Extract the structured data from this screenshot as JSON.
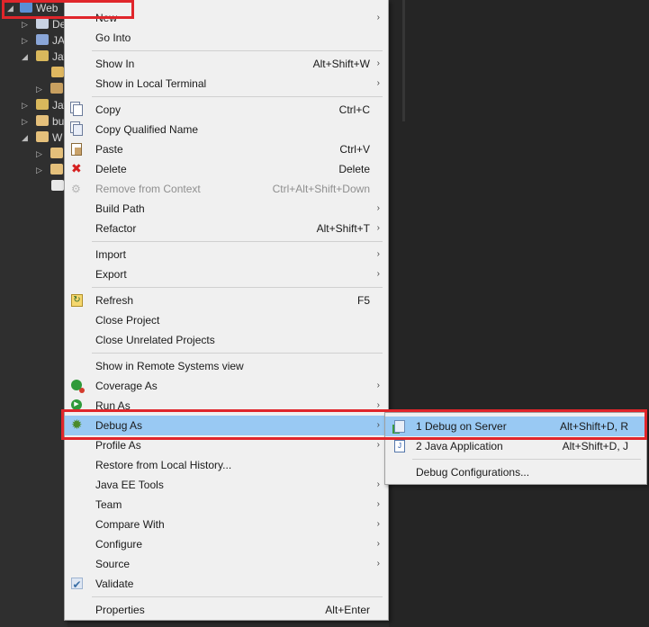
{
  "explorer": {
    "rows": [
      {
        "label": "Web",
        "twisty": "◢",
        "icon": "project-icon"
      },
      {
        "label": "De",
        "twisty": "▷",
        "icon": "deployment-descriptor-icon"
      },
      {
        "label": "JA",
        "twisty": "▷",
        "icon": "jaxws-icon"
      },
      {
        "label": "Jav",
        "twisty": "◢",
        "icon": "java-resources-icon"
      },
      {
        "label": "",
        "twisty": "",
        "icon": "package-folder-icon"
      },
      {
        "label": "",
        "twisty": "▷",
        "icon": "libraries-icon"
      },
      {
        "label": "Jav",
        "twisty": "▷",
        "icon": "java-script-resources-icon"
      },
      {
        "label": "bu",
        "twisty": "▷",
        "icon": "folder-icon"
      },
      {
        "label": "W",
        "twisty": "◢",
        "icon": "folder-icon"
      },
      {
        "label": "",
        "twisty": "▷",
        "icon": "folder-icon"
      },
      {
        "label": "",
        "twisty": "▷",
        "icon": "folder-icon"
      },
      {
        "label": "",
        "twisty": "",
        "icon": "file-icon"
      }
    ]
  },
  "menu": {
    "items": [
      {
        "label": "New",
        "arrow": "›"
      },
      {
        "label": "Go Into"
      },
      {
        "sep": true
      },
      {
        "label": "Show In",
        "shortcut": "Alt+Shift+W",
        "arrow": "›"
      },
      {
        "label": "Show in Local Terminal",
        "arrow": "›"
      },
      {
        "sep": true
      },
      {
        "label": "Copy",
        "shortcut": "Ctrl+C",
        "icon": "copy-icon"
      },
      {
        "label": "Copy Qualified Name",
        "icon": "copy-qualified-icon"
      },
      {
        "label": "Paste",
        "shortcut": "Ctrl+V",
        "icon": "paste-icon"
      },
      {
        "label": "Delete",
        "shortcut": "Delete",
        "icon": "delete-icon"
      },
      {
        "label": "Remove from Context",
        "shortcut": "Ctrl+Alt+Shift+Down",
        "icon": "remove-context-icon",
        "disabled": true
      },
      {
        "label": "Build Path",
        "arrow": "›"
      },
      {
        "label": "Refactor",
        "shortcut": "Alt+Shift+T",
        "arrow": "›"
      },
      {
        "sep": true
      },
      {
        "label": "Import",
        "arrow": "›"
      },
      {
        "label": "Export",
        "arrow": "›"
      },
      {
        "sep": true
      },
      {
        "label": "Refresh",
        "shortcut": "F5",
        "icon": "refresh-icon"
      },
      {
        "label": "Close Project"
      },
      {
        "label": "Close Unrelated Projects"
      },
      {
        "sep": true
      },
      {
        "label": "Show in Remote Systems view"
      },
      {
        "label": "Coverage As",
        "arrow": "›",
        "icon": "coverage-icon"
      },
      {
        "label": "Run As",
        "arrow": "›",
        "icon": "run-icon"
      },
      {
        "label": "Debug As",
        "arrow": "›",
        "icon": "debug-icon",
        "highlighted": true
      },
      {
        "label": "Profile As",
        "arrow": "›"
      },
      {
        "label": "Restore from Local History..."
      },
      {
        "label": "Java EE Tools",
        "arrow": "›"
      },
      {
        "label": "Team",
        "arrow": "›"
      },
      {
        "label": "Compare With",
        "arrow": "›"
      },
      {
        "label": "Configure",
        "arrow": "›"
      },
      {
        "label": "Source",
        "arrow": "›"
      },
      {
        "label": "Validate",
        "icon": "checkmark-icon"
      },
      {
        "sep": true
      },
      {
        "label": "Properties",
        "shortcut": "Alt+Enter"
      }
    ]
  },
  "submenu": {
    "items": [
      {
        "label": "1 Debug on Server",
        "shortcut": "Alt+Shift+D, R",
        "icon": "server-icon",
        "highlighted": true
      },
      {
        "label": "2 Java Application",
        "shortcut": "Alt+Shift+D, J",
        "icon": "java-app-icon"
      },
      {
        "sep": true
      },
      {
        "label": "Debug Configurations..."
      }
    ]
  },
  "colors": {
    "highlight": "#99c9f3",
    "annotation_red": "#e0262b",
    "menu_bg": "#f0f0f0",
    "dark_bg": "#2b2b2b"
  }
}
